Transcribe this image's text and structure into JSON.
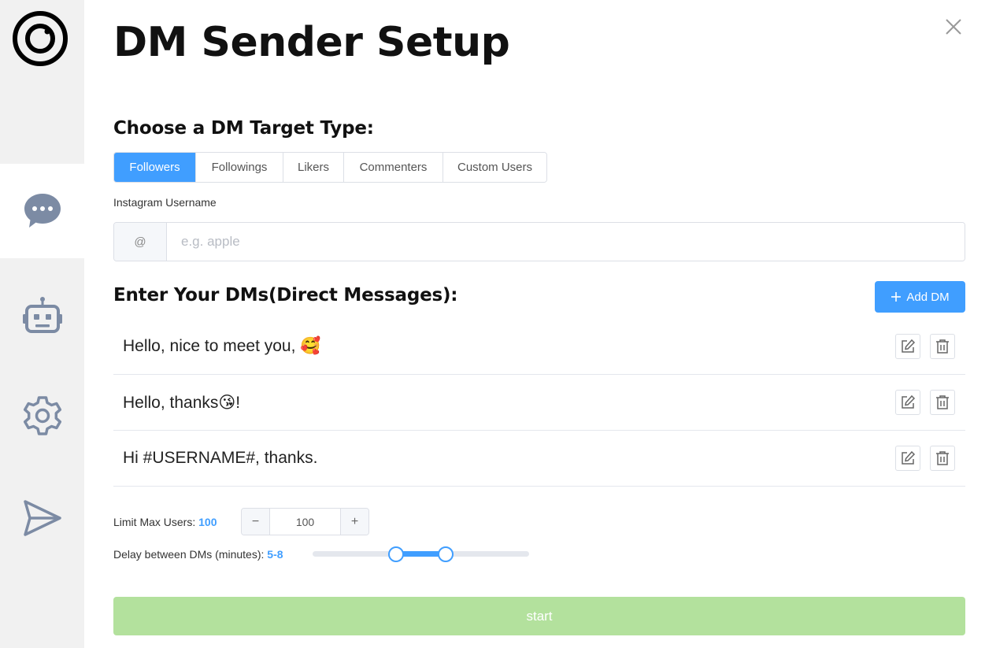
{
  "app": {
    "title": "DM Sender Setup",
    "accent_color": "#409eff",
    "start_color": "#b3e19d"
  },
  "sidebar": {
    "logo_icon": "circle-logo-icon",
    "items": [
      {
        "id": "messages",
        "icon": "chat-bubble-icon",
        "active": true
      },
      {
        "id": "bot",
        "icon": "robot-icon",
        "active": false
      },
      {
        "id": "settings",
        "icon": "gear-icon",
        "active": false
      },
      {
        "id": "send",
        "icon": "send-icon",
        "active": false
      }
    ]
  },
  "target": {
    "heading": "Choose a DM Target Type:",
    "tabs": [
      {
        "label": "Followers",
        "active": true
      },
      {
        "label": "Followings",
        "active": false
      },
      {
        "label": "Likers",
        "active": false
      },
      {
        "label": "Commenters",
        "active": false
      },
      {
        "label": "Custom Users",
        "active": false
      }
    ],
    "username_label": "Instagram Username",
    "username_prefix": "@",
    "username_placeholder": "e.g. apple",
    "username_value": ""
  },
  "dms": {
    "heading": "Enter Your DMs(Direct Messages):",
    "add_label": "Add DM",
    "items": [
      {
        "text": "Hello, nice to meet you, 🥰"
      },
      {
        "text": "Hello, thanks😘!"
      },
      {
        "text": "Hi #USERNAME#, thanks."
      }
    ]
  },
  "limits": {
    "max_users_label": "Limit Max Users:",
    "max_users_value": "100",
    "stepper_value": "100",
    "delay_label": "Delay between DMs (minutes):",
    "delay_value": "5-8",
    "delay_min": 0,
    "delay_max": 13,
    "delay_low": 5,
    "delay_high": 8
  },
  "actions": {
    "start_label": "start"
  }
}
